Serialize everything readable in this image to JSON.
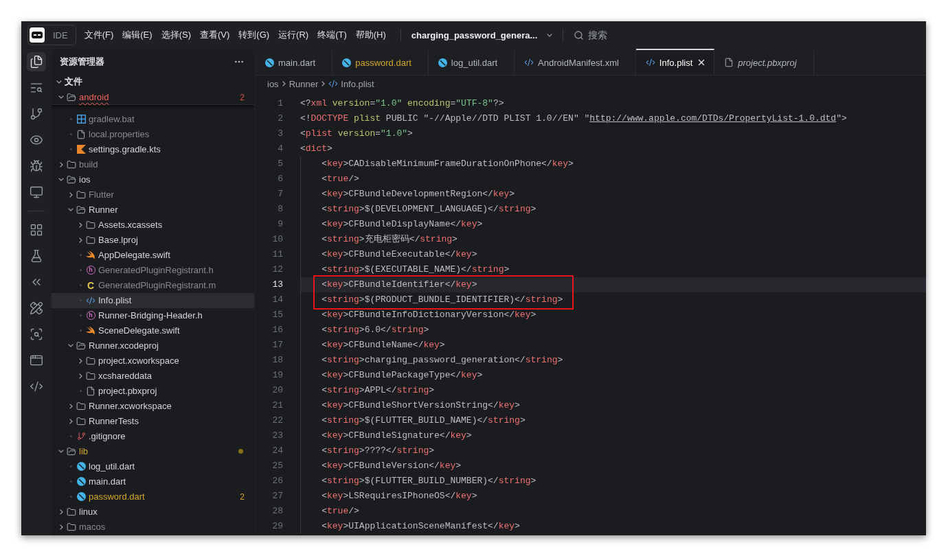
{
  "title_bar": {
    "app_label": "IDE",
    "menus": [
      "文件(F)",
      "编辑(E)",
      "选择(S)",
      "查看(V)",
      "转到(G)",
      "运行(R)",
      "终端(T)",
      "帮助(H)"
    ],
    "project": "charging_password_genera...",
    "search": {
      "placeholder": "搜索"
    }
  },
  "activity_bar": {
    "groups": [
      {
        "items": [
          {
            "kind": "explorer",
            "selected": true
          },
          {
            "kind": "search",
            "selected": false
          },
          {
            "kind": "source_control",
            "selected": false
          },
          {
            "kind": "preview",
            "selected": false
          },
          {
            "kind": "debug",
            "selected": false
          },
          {
            "kind": "remote",
            "selected": false
          }
        ]
      },
      {
        "items": [
          {
            "kind": "extensions",
            "selected": false
          },
          {
            "kind": "testing",
            "selected": false
          },
          {
            "kind": "flutter",
            "selected": false
          },
          {
            "kind": "draw",
            "selected": false
          },
          {
            "kind": "scan",
            "selected": false
          },
          {
            "kind": "inspector",
            "selected": false
          },
          {
            "kind": "code",
            "selected": false
          }
        ]
      }
    ]
  },
  "sidebar": {
    "title": "资源管理器",
    "section": {
      "label": "文件",
      "expanded": true,
      "items": [
        {
          "name": "android",
          "kind": "folder",
          "expanded": true,
          "error": true,
          "modified": false,
          "ignored": false,
          "badge": "2",
          "pinned": true,
          "selected": false,
          "children": [
            {
              "name": "gradlew.bat",
              "kind": "windows",
              "error": false,
              "modified": false,
              "ignored": true,
              "selected": false
            },
            {
              "name": "local.properties",
              "kind": "file",
              "error": false,
              "modified": false,
              "ignored": true,
              "selected": false
            },
            {
              "name": "settings.gradle.kts",
              "kind": "kotlin",
              "error": false,
              "modified": false,
              "ignored": false,
              "selected": false
            }
          ]
        },
        {
          "name": "build",
          "kind": "folder",
          "expanded": false,
          "error": false,
          "modified": false,
          "ignored": true,
          "pinned": false,
          "selected": false
        },
        {
          "name": "ios",
          "kind": "folder",
          "expanded": true,
          "error": false,
          "modified": false,
          "ignored": false,
          "pinned": false,
          "selected": false,
          "children": [
            {
              "name": "Flutter",
              "kind": "folder",
              "expanded": false,
              "error": false,
              "modified": false,
              "ignored": true,
              "selected": false
            },
            {
              "name": "Runner",
              "kind": "folder",
              "expanded": true,
              "error": false,
              "modified": false,
              "ignored": false,
              "selected": false,
              "children": [
                {
                  "name": "Assets.xcassets",
                  "kind": "folder",
                  "expanded": false,
                  "error": false,
                  "modified": false,
                  "ignored": false,
                  "selected": false
                },
                {
                  "name": "Base.lproj",
                  "kind": "folder",
                  "expanded": false,
                  "error": false,
                  "modified": false,
                  "ignored": false,
                  "selected": false
                },
                {
                  "name": "AppDelegate.swift",
                  "kind": "swift",
                  "error": false,
                  "modified": false,
                  "ignored": false,
                  "selected": false
                },
                {
                  "name": "GeneratedPluginRegistrant.h",
                  "kind": "header",
                  "glyph": "h",
                  "error": false,
                  "modified": false,
                  "ignored": true,
                  "selected": false
                },
                {
                  "name": "GeneratedPluginRegistrant.m",
                  "kind": "source",
                  "glyph": "C",
                  "error": false,
                  "modified": false,
                  "ignored": true,
                  "selected": false
                },
                {
                  "name": "Info.plist",
                  "kind": "xml",
                  "error": false,
                  "modified": false,
                  "ignored": false,
                  "selected": true
                },
                {
                  "name": "Runner-Bridging-Header.h",
                  "kind": "header",
                  "glyph": "h",
                  "error": false,
                  "modified": false,
                  "ignored": false,
                  "selected": false
                },
                {
                  "name": "SceneDelegate.swift",
                  "kind": "swift",
                  "error": false,
                  "modified": false,
                  "ignored": false,
                  "selected": false
                }
              ]
            },
            {
              "name": "Runner.xcodeproj",
              "kind": "folder",
              "expanded": true,
              "error": false,
              "modified": false,
              "ignored": false,
              "selected": false,
              "children": [
                {
                  "name": "project.xcworkspace",
                  "kind": "folder",
                  "expanded": false,
                  "error": false,
                  "modified": false,
                  "ignored": false,
                  "selected": false
                },
                {
                  "name": "xcshareddata",
                  "kind": "folder",
                  "expanded": false,
                  "error": false,
                  "modified": false,
                  "ignored": false,
                  "selected": false
                },
                {
                  "name": "project.pbxproj",
                  "kind": "file",
                  "error": false,
                  "modified": false,
                  "ignored": false,
                  "selected": false
                }
              ]
            },
            {
              "name": "Runner.xcworkspace",
              "kind": "folder",
              "expanded": false,
              "error": false,
              "modified": false,
              "ignored": false,
              "selected": false
            },
            {
              "name": "RunnerTests",
              "kind": "folder",
              "expanded": false,
              "error": false,
              "modified": false,
              "ignored": false,
              "selected": false
            },
            {
              "name": ".gitignore",
              "kind": "git",
              "error": false,
              "modified": false,
              "ignored": false,
              "selected": false
            }
          ]
        },
        {
          "name": "lib",
          "kind": "folder",
          "expanded": true,
          "error": false,
          "modified": true,
          "ignored": false,
          "pinned": false,
          "selected": false,
          "children": [
            {
              "name": "log_util.dart",
              "kind": "dart",
              "error": false,
              "modified": false,
              "ignored": false,
              "selected": false
            },
            {
              "name": "main.dart",
              "kind": "dart",
              "error": false,
              "modified": false,
              "ignored": false,
              "selected": false
            },
            {
              "name": "password.dart",
              "kind": "dart",
              "error": false,
              "modified": true,
              "ignored": false,
              "badge": "2",
              "selected": false
            }
          ]
        },
        {
          "name": "linux",
          "kind": "folder",
          "expanded": false,
          "error": false,
          "modified": false,
          "ignored": false,
          "pinned": false,
          "selected": false
        },
        {
          "name": "macos",
          "kind": "folder",
          "expanded": false,
          "error": false,
          "modified": false,
          "ignored": true,
          "pinned": false,
          "selected": false
        }
      ]
    }
  },
  "editor": {
    "tabs": [
      {
        "label": "main.dart",
        "kind": "dart",
        "modified": false,
        "preview": false,
        "selected": false
      },
      {
        "label": "password.dart",
        "kind": "dart",
        "modified": true,
        "preview": false,
        "selected": false
      },
      {
        "label": "log_util.dart",
        "kind": "dart",
        "modified": false,
        "preview": false,
        "selected": false
      },
      {
        "label": "AndroidManifest.xml",
        "kind": "xml",
        "modified": false,
        "preview": false,
        "selected": false
      },
      {
        "label": "Info.plist",
        "kind": "xml",
        "modified": false,
        "preview": false,
        "selected": true
      },
      {
        "label": "project.pbxproj",
        "kind": "file",
        "modified": false,
        "preview": true,
        "selected": false
      }
    ],
    "breadcrumbs": [
      {
        "label": "ios",
        "kind": "folder"
      },
      {
        "label": "Runner",
        "kind": "folder"
      },
      {
        "label": "Info.plist",
        "kind": "xml"
      }
    ],
    "lines": [
      {
        "number": "1",
        "current": false,
        "boxed": false,
        "tokens": [
          {
            "kind": "text",
            "text": "<?"
          },
          {
            "kind": "tag",
            "text": "xml"
          },
          {
            "kind": "attr",
            "text": " version"
          },
          {
            "kind": "text",
            "text": "="
          },
          {
            "kind": "string",
            "text": "\"1.0\""
          },
          {
            "kind": "attr",
            "text": " encoding"
          },
          {
            "kind": "text",
            "text": "="
          },
          {
            "kind": "string",
            "text": "\"UTF-8\""
          },
          {
            "kind": "text",
            "text": "?>"
          }
        ]
      },
      {
        "number": "2",
        "current": false,
        "boxed": false,
        "tokens": [
          {
            "kind": "text",
            "text": "<!"
          },
          {
            "kind": "tag",
            "text": "DOCTYPE"
          },
          {
            "kind": "attr",
            "text": " plist"
          },
          {
            "kind": "text",
            "text": " PUBLIC \"-//Apple//DTD PLIST 1.0//EN\" \""
          },
          {
            "kind": "link",
            "text": "http://www.apple.com/DTDs/PropertyList-1.0.dtd"
          },
          {
            "kind": "text",
            "text": "\">"
          }
        ]
      },
      {
        "number": "3",
        "current": false,
        "boxed": false,
        "tokens": [
          {
            "kind": "text",
            "text": "<"
          },
          {
            "kind": "tag",
            "text": "plist"
          },
          {
            "kind": "attr",
            "text": " version"
          },
          {
            "kind": "text",
            "text": "="
          },
          {
            "kind": "string",
            "text": "\"1.0\""
          },
          {
            "kind": "text",
            "text": ">"
          }
        ]
      },
      {
        "number": "4",
        "current": false,
        "boxed": false,
        "tokens": [
          {
            "kind": "text",
            "text": "<"
          },
          {
            "kind": "tag",
            "text": "dict"
          },
          {
            "kind": "text",
            "text": ">"
          }
        ],
        "children": [
          {
            "number": "5",
            "current": false,
            "boxed": false,
            "tokens": [
              {
                "kind": "text",
                "text": "<"
              },
              {
                "kind": "tag",
                "text": "key"
              },
              {
                "kind": "text",
                "text": ">CADisableMinimumFrameDurationOnPhone</"
              },
              {
                "kind": "tag",
                "text": "key"
              },
              {
                "kind": "text",
                "text": ">"
              }
            ]
          },
          {
            "number": "6",
            "current": false,
            "boxed": false,
            "tokens": [
              {
                "kind": "text",
                "text": "<"
              },
              {
                "kind": "tag",
                "text": "true"
              },
              {
                "kind": "text",
                "text": "/>"
              }
            ]
          },
          {
            "number": "7",
            "current": false,
            "boxed": false,
            "tokens": [
              {
                "kind": "text",
                "text": "<"
              },
              {
                "kind": "tag",
                "text": "key"
              },
              {
                "kind": "text",
                "text": ">CFBundleDevelopmentRegion</"
              },
              {
                "kind": "tag",
                "text": "key"
              },
              {
                "kind": "text",
                "text": ">"
              }
            ]
          },
          {
            "number": "8",
            "current": false,
            "boxed": false,
            "tokens": [
              {
                "kind": "text",
                "text": "<"
              },
              {
                "kind": "tag",
                "text": "string"
              },
              {
                "kind": "text",
                "text": ">$(DEVELOPMENT_LANGUAGE)</"
              },
              {
                "kind": "tag",
                "text": "string"
              },
              {
                "kind": "text",
                "text": ">"
              }
            ]
          },
          {
            "number": "9",
            "current": false,
            "boxed": false,
            "tokens": [
              {
                "kind": "text",
                "text": "<"
              },
              {
                "kind": "tag",
                "text": "key"
              },
              {
                "kind": "text",
                "text": ">CFBundleDisplayName</"
              },
              {
                "kind": "tag",
                "text": "key"
              },
              {
                "kind": "text",
                "text": ">"
              }
            ]
          },
          {
            "number": "10",
            "current": false,
            "boxed": false,
            "tokens": [
              {
                "kind": "text",
                "text": "<"
              },
              {
                "kind": "tag",
                "text": "string"
              },
              {
                "kind": "text",
                "text": ">充电柜密码</"
              },
              {
                "kind": "tag",
                "text": "string"
              },
              {
                "kind": "text",
                "text": ">"
              }
            ]
          },
          {
            "number": "11",
            "current": false,
            "boxed": false,
            "tokens": [
              {
                "kind": "text",
                "text": "<"
              },
              {
                "kind": "tag",
                "text": "key"
              },
              {
                "kind": "text",
                "text": ">CFBundleExecutable</"
              },
              {
                "kind": "tag",
                "text": "key"
              },
              {
                "kind": "text",
                "text": ">"
              }
            ]
          },
          {
            "number": "12",
            "current": false,
            "boxed": false,
            "tokens": [
              {
                "kind": "text",
                "text": "<"
              },
              {
                "kind": "tag",
                "text": "string"
              },
              {
                "kind": "text",
                "text": ">$(EXECUTABLE_NAME)</"
              },
              {
                "kind": "tag",
                "text": "string"
              },
              {
                "kind": "text",
                "text": ">"
              }
            ]
          },
          {
            "number": "13",
            "current": true,
            "boxed": true,
            "tokens": [
              {
                "kind": "text",
                "text": "<"
              },
              {
                "kind": "tag",
                "text": "key"
              },
              {
                "kind": "text",
                "text": ">CFBundleIdentifier</"
              },
              {
                "kind": "tag",
                "text": "key"
              },
              {
                "kind": "text",
                "text": ">"
              }
            ]
          },
          {
            "number": "14",
            "current": false,
            "boxed": true,
            "tokens": [
              {
                "kind": "text",
                "text": "<"
              },
              {
                "kind": "tag",
                "text": "string"
              },
              {
                "kind": "text",
                "text": ">$(PRODUCT_BUNDLE_IDENTIFIER)</"
              },
              {
                "kind": "tag",
                "text": "string"
              },
              {
                "kind": "text",
                "text": ">"
              }
            ]
          },
          {
            "number": "15",
            "current": false,
            "boxed": false,
            "tokens": [
              {
                "kind": "text",
                "text": "<"
              },
              {
                "kind": "tag",
                "text": "key"
              },
              {
                "kind": "text",
                "text": ">CFBundleInfoDictionaryVersion</"
              },
              {
                "kind": "tag",
                "text": "key"
              },
              {
                "kind": "text",
                "text": ">"
              }
            ]
          },
          {
            "number": "16",
            "current": false,
            "boxed": false,
            "tokens": [
              {
                "kind": "text",
                "text": "<"
              },
              {
                "kind": "tag",
                "text": "string"
              },
              {
                "kind": "text",
                "text": ">6.0</"
              },
              {
                "kind": "tag",
                "text": "string"
              },
              {
                "kind": "text",
                "text": ">"
              }
            ]
          },
          {
            "number": "17",
            "current": false,
            "boxed": false,
            "tokens": [
              {
                "kind": "text",
                "text": "<"
              },
              {
                "kind": "tag",
                "text": "key"
              },
              {
                "kind": "text",
                "text": ">CFBundleName</"
              },
              {
                "kind": "tag",
                "text": "key"
              },
              {
                "kind": "text",
                "text": ">"
              }
            ]
          },
          {
            "number": "18",
            "current": false,
            "boxed": false,
            "tokens": [
              {
                "kind": "text",
                "text": "<"
              },
              {
                "kind": "tag",
                "text": "string"
              },
              {
                "kind": "text",
                "text": ">charging_password_generation</"
              },
              {
                "kind": "tag",
                "text": "string"
              },
              {
                "kind": "text",
                "text": ">"
              }
            ]
          },
          {
            "number": "19",
            "current": false,
            "boxed": false,
            "tokens": [
              {
                "kind": "text",
                "text": "<"
              },
              {
                "kind": "tag",
                "text": "key"
              },
              {
                "kind": "text",
                "text": ">CFBundlePackageType</"
              },
              {
                "kind": "tag",
                "text": "key"
              },
              {
                "kind": "text",
                "text": ">"
              }
            ]
          },
          {
            "number": "20",
            "current": false,
            "boxed": false,
            "tokens": [
              {
                "kind": "text",
                "text": "<"
              },
              {
                "kind": "tag",
                "text": "string"
              },
              {
                "kind": "text",
                "text": ">APPL</"
              },
              {
                "kind": "tag",
                "text": "string"
              },
              {
                "kind": "text",
                "text": ">"
              }
            ]
          },
          {
            "number": "21",
            "current": false,
            "boxed": false,
            "tokens": [
              {
                "kind": "text",
                "text": "<"
              },
              {
                "kind": "tag",
                "text": "key"
              },
              {
                "kind": "text",
                "text": ">CFBundleShortVersionString</"
              },
              {
                "kind": "tag",
                "text": "key"
              },
              {
                "kind": "text",
                "text": ">"
              }
            ]
          },
          {
            "number": "22",
            "current": false,
            "boxed": false,
            "tokens": [
              {
                "kind": "text",
                "text": "<"
              },
              {
                "kind": "tag",
                "text": "string"
              },
              {
                "kind": "text",
                "text": ">$(FLUTTER_BUILD_NAME)</"
              },
              {
                "kind": "tag",
                "text": "string"
              },
              {
                "kind": "text",
                "text": ">"
              }
            ]
          },
          {
            "number": "23",
            "current": false,
            "boxed": false,
            "tokens": [
              {
                "kind": "text",
                "text": "<"
              },
              {
                "kind": "tag",
                "text": "key"
              },
              {
                "kind": "text",
                "text": ">CFBundleSignature</"
              },
              {
                "kind": "tag",
                "text": "key"
              },
              {
                "kind": "text",
                "text": ">"
              }
            ]
          },
          {
            "number": "24",
            "current": false,
            "boxed": false,
            "tokens": [
              {
                "kind": "text",
                "text": "<"
              },
              {
                "kind": "tag",
                "text": "string"
              },
              {
                "kind": "text",
                "text": ">????</"
              },
              {
                "kind": "tag",
                "text": "string"
              },
              {
                "kind": "text",
                "text": ">"
              }
            ]
          },
          {
            "number": "25",
            "current": false,
            "boxed": false,
            "tokens": [
              {
                "kind": "text",
                "text": "<"
              },
              {
                "kind": "tag",
                "text": "key"
              },
              {
                "kind": "text",
                "text": ">CFBundleVersion</"
              },
              {
                "kind": "tag",
                "text": "key"
              },
              {
                "kind": "text",
                "text": ">"
              }
            ]
          },
          {
            "number": "26",
            "current": false,
            "boxed": false,
            "tokens": [
              {
                "kind": "text",
                "text": "<"
              },
              {
                "kind": "tag",
                "text": "string"
              },
              {
                "kind": "text",
                "text": ">$(FLUTTER_BUILD_NUMBER)</"
              },
              {
                "kind": "tag",
                "text": "string"
              },
              {
                "kind": "text",
                "text": ">"
              }
            ]
          },
          {
            "number": "27",
            "current": false,
            "boxed": false,
            "tokens": [
              {
                "kind": "text",
                "text": "<"
              },
              {
                "kind": "tag",
                "text": "key"
              },
              {
                "kind": "text",
                "text": ">LSRequiresIPhoneOS</"
              },
              {
                "kind": "tag",
                "text": "key"
              },
              {
                "kind": "text",
                "text": ">"
              }
            ]
          },
          {
            "number": "28",
            "current": false,
            "boxed": false,
            "tokens": [
              {
                "kind": "text",
                "text": "<"
              },
              {
                "kind": "tag",
                "text": "true"
              },
              {
                "kind": "text",
                "text": "/>"
              }
            ]
          },
          {
            "number": "29",
            "current": false,
            "boxed": false,
            "tokens": [
              {
                "kind": "text",
                "text": "<"
              },
              {
                "kind": "tag",
                "text": "key"
              },
              {
                "kind": "text",
                "text": ">UIApplicationSceneManifest</"
              },
              {
                "kind": "tag",
                "text": "key"
              },
              {
                "kind": "text",
                "text": ">"
              }
            ]
          }
        ]
      }
    ]
  }
}
